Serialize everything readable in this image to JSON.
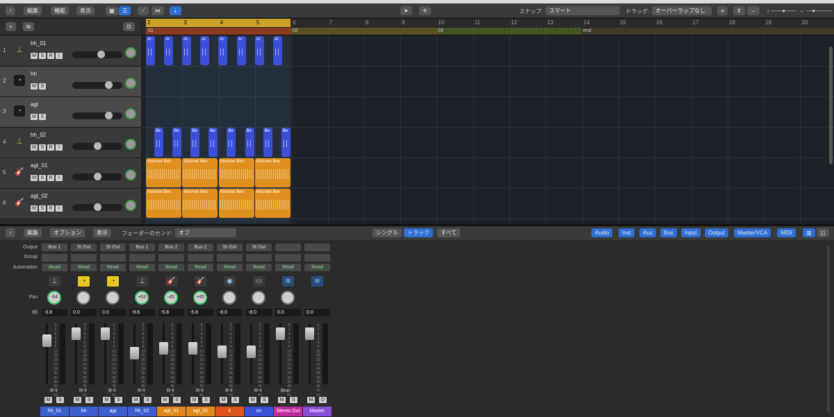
{
  "toolbar": {
    "back": "↑",
    "edit": "編集",
    "functions": "機能",
    "view": "表示",
    "snap_label": "スナップ:",
    "snap_value": "スマート",
    "drag_label": "ドラッグ:",
    "drag_value": "オーバーラップなし"
  },
  "ruler": {
    "bars": [
      "2",
      "3",
      "4",
      "5",
      "6",
      "7",
      "8",
      "9",
      "10",
      "11",
      "12",
      "13",
      "14",
      "15",
      "16",
      "17",
      "18",
      "19",
      "20"
    ]
  },
  "markers": [
    {
      "label": "01"
    },
    {
      "label": "02"
    },
    {
      "label": "03"
    },
    {
      "label": "end"
    }
  ],
  "tracks": [
    {
      "num": "1",
      "name": "hh_01",
      "icon": "hihat-icon",
      "type": "midi"
    },
    {
      "num": "2",
      "name": "hh",
      "icon": "tempo-icon",
      "type": "tempo"
    },
    {
      "num": "3",
      "name": "agt",
      "icon": "tempo-icon",
      "type": "tempo"
    },
    {
      "num": "4",
      "name": "hh_02",
      "icon": "hihat-icon",
      "type": "midi"
    },
    {
      "num": "5",
      "name": "agt_01",
      "icon": "guitar-icon",
      "type": "audio"
    },
    {
      "num": "6",
      "name": "agt_02",
      "icon": "guitar-icon",
      "type": "audio"
    }
  ],
  "buttons": {
    "m": "M",
    "s": "S",
    "r": "R",
    "i": "I"
  },
  "regions": {
    "midi_a": "Ar",
    "midi_b": "Be",
    "audio": "Klezmer Ben"
  },
  "mixer_toolbar": {
    "back": "↑",
    "edit": "編集",
    "options": "オプション",
    "view": "表示",
    "sends_label": "フェーダーのセンド:",
    "sends_value": "オフ",
    "single": "シングル",
    "tracks": "トラック",
    "all": "すべて",
    "filters": [
      "Audio",
      "Inst",
      "Aux",
      "Bus",
      "Input",
      "Output",
      "Master/VCA",
      "MIDI"
    ]
  },
  "mixer_rows": {
    "output": "Output",
    "group": "Group",
    "automation": "Automation",
    "pan": "Pan",
    "db": "dB"
  },
  "strips": [
    {
      "output": "Bus 1",
      "auto": "Read",
      "icon": "hihat-icon",
      "pan": "-64",
      "db": "-3.8",
      "name": "hh_01",
      "color": "#3c5fd0"
    },
    {
      "output": "St Out",
      "auto": "Read",
      "icon": "tempo-icon",
      "pan": "",
      "db": "0.0",
      "name": "hh",
      "color": "#3c5fd0"
    },
    {
      "output": "St Out",
      "auto": "Read",
      "icon": "tempo-icon",
      "pan": "",
      "db": "0.0",
      "name": "agt",
      "color": "#3c5fd0"
    },
    {
      "output": "Bus 1",
      "auto": "Read",
      "icon": "hihat-icon",
      "pan": "+63",
      "db": "-9.6",
      "name": "hh_02",
      "color": "#3c5fd0"
    },
    {
      "output": "Bus 2",
      "auto": "Read",
      "icon": "guitar-icon",
      "pan": "-45",
      "db": "-5.8",
      "name": "agt_01",
      "color": "#e08a1e"
    },
    {
      "output": "Bus 2",
      "auto": "Read",
      "icon": "guitar-icon",
      "pan": "+45",
      "db": "-5.8",
      "name": "agt_02",
      "color": "#e08a1e"
    },
    {
      "output": "St Out",
      "auto": "Read",
      "icon": "kick-icon",
      "pan": "",
      "db": "-8.0",
      "name": "k",
      "color": "#e0541e"
    },
    {
      "output": "St Out",
      "auto": "Read",
      "icon": "snare-icon",
      "pan": "",
      "db": "-8.0",
      "name": "sn",
      "color": "#3c4fd9"
    },
    {
      "output": "",
      "auto": "Read",
      "icon": "waveform-icon",
      "pan": "",
      "db": "0.0",
      "name": "Stereo Out",
      "color": "#c22aa0",
      "extra": "Bnc"
    },
    {
      "output": "",
      "auto": "Read",
      "icon": "waveform-icon",
      "pan": "",
      "db": "0.0",
      "name": "Master",
      "color": "#8a4fd6",
      "master": true
    }
  ],
  "scale": [
    "6",
    "3",
    "0",
    "3",
    "6",
    "9",
    "12",
    "15",
    "18",
    "21",
    "24",
    "30",
    "35",
    "40",
    "45",
    "50",
    "60"
  ]
}
